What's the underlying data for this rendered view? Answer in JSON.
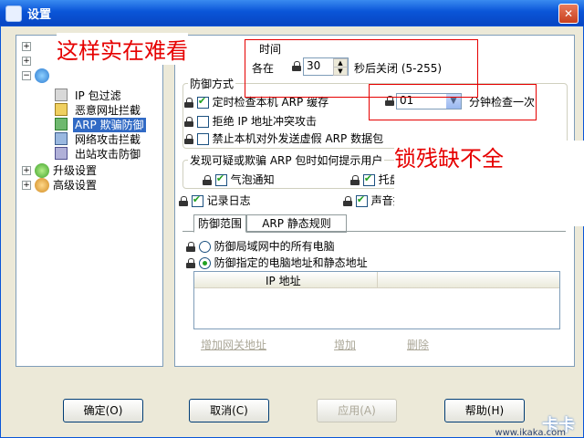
{
  "window": {
    "title": "设置",
    "close_glyph": "✕"
  },
  "tree": {
    "items": [
      {
        "label": "IP 包过滤"
      },
      {
        "label": "恶意网址拦截"
      },
      {
        "label": "ARP 欺骗防御"
      },
      {
        "label": "网络攻击拦截"
      },
      {
        "label": "出站攻击防御"
      },
      {
        "label": "升级设置"
      },
      {
        "label": "高级设置"
      }
    ],
    "expand_glyph": "+",
    "collapse_glyph": "−"
  },
  "top": {
    "frag_time": "时间",
    "frag_ge": "各在",
    "seconds_value": "30",
    "seconds_suffix": "秒后关闭 (5-255)"
  },
  "defense_method": {
    "title": "防御方式",
    "timed_check": "定时检查本机 ARP 缓存",
    "interval_value": "01",
    "interval_suffix": "分钟检查一次",
    "reject_conflict": "拒绝 IP 地址冲突攻击",
    "forbid_send": "禁止本机对外发送虚假 ARP 数据包"
  },
  "notify": {
    "title": "发现可疑或欺骗 ARP 包时如何提示用户",
    "bubble": "气泡通知",
    "tray": "托盘"
  },
  "log": {
    "record_log": "记录日志",
    "sound": "声音报"
  },
  "tabs": {
    "scope": "防御范围",
    "static_rules": "ARP 静态规则"
  },
  "scope": {
    "all_pcs": "防御局域网中的所有电脑",
    "specified": "防御指定的电脑地址和静态地址",
    "table_header_ip": "IP 地址",
    "add_gateway": "增加网关地址",
    "add": "增加",
    "delete": "删除"
  },
  "buttons": {
    "ok": "确定(O)",
    "cancel": "取消(C)",
    "apply": "应用(A)",
    "help": "帮助(H)"
  },
  "annotations": {
    "ugly": "这样实在难看",
    "lock_broken": "锁残缺不全"
  },
  "watermark": {
    "brand": "卡卡",
    "url": "www.ikaka.com"
  },
  "icons": [
    "app-icon",
    "close-icon",
    "lock-icon",
    "checkbox-icon",
    "radio-icon",
    "spin-up-icon",
    "spin-down-icon",
    "dropdown-arrow-icon",
    "upgrade-icon",
    "advanced-icon",
    "shield-icon"
  ]
}
